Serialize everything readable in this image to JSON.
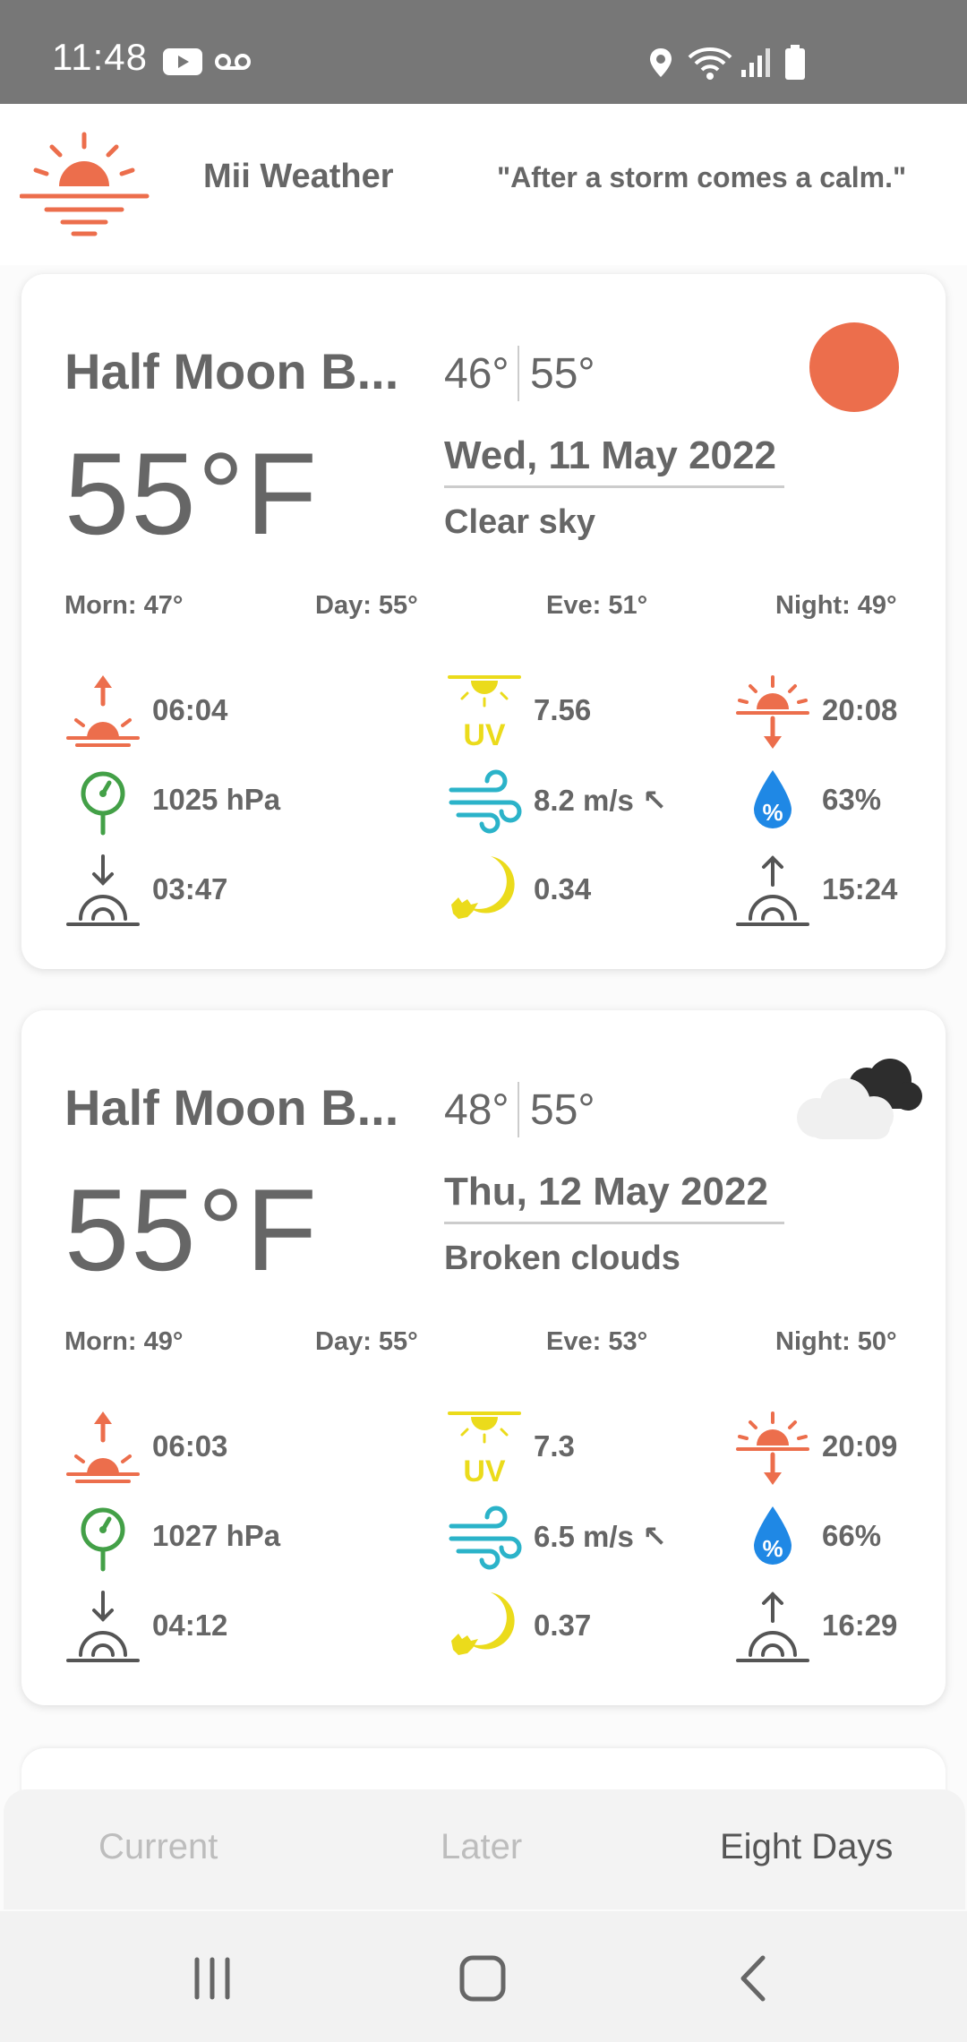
{
  "status_bar": {
    "time": "11:48",
    "icons": [
      "youtube-icon",
      "voicemail-icon",
      "location-icon",
      "wifi-icon",
      "signal-icon",
      "battery-icon"
    ]
  },
  "header": {
    "app_name": "Mii Weather",
    "quote": "\"After a storm comes a calm.\""
  },
  "cards": [
    {
      "place": "Half Moon B...",
      "temp": "55°F",
      "low": "46°",
      "high": "55°",
      "date": "Wed, 11 May 2022",
      "description": "Clear sky",
      "weather_icon": "sun-icon",
      "morn": "Morn: 47°",
      "day": "Day: 55°",
      "eve": "Eve: 51°",
      "night": "Night: 49°",
      "sunrise": "06:04",
      "uv": "7.56",
      "sunset": "20:08",
      "pressure": "1025 hPa",
      "wind": "8.2 m/s ↖",
      "humidity": "63%",
      "moonset": "03:47",
      "moon_phase": "0.34",
      "moonrise": "15:24"
    },
    {
      "place": "Half Moon B...",
      "temp": "55°F",
      "low": "48°",
      "high": "55°",
      "date": "Thu, 12 May 2022",
      "description": "Broken clouds",
      "weather_icon": "broken-clouds-icon",
      "morn": "Morn: 49°",
      "day": "Day: 55°",
      "eve": "Eve: 53°",
      "night": "Night: 50°",
      "sunrise": "06:03",
      "uv": "7.3",
      "sunset": "20:09",
      "pressure": "1027 hPa",
      "wind": "6.5 m/s ↖",
      "humidity": "66%",
      "moonset": "04:12",
      "moon_phase": "0.37",
      "moonrise": "16:29"
    }
  ],
  "tabs": [
    {
      "label": "Current",
      "active": false
    },
    {
      "label": "Later",
      "active": false
    },
    {
      "label": "Eight Days",
      "active": true
    }
  ],
  "colors": {
    "accent": "#EC6E4C",
    "uv_yellow": "#EBDB1B",
    "wind_cyan": "#2BB3C9",
    "humidity_blue": "#1F88E5",
    "pressure_green": "#43A047",
    "text": "#666666"
  }
}
